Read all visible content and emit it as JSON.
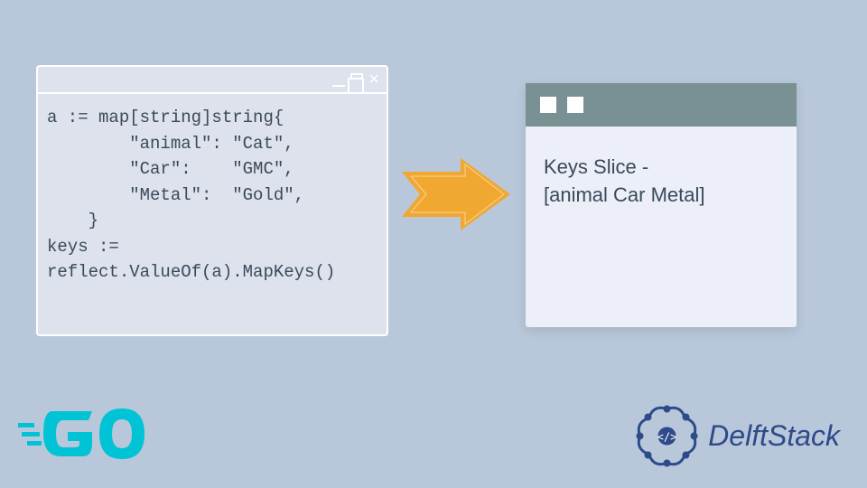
{
  "code": {
    "line1": "a := map[string]string{",
    "line2": "        \"animal\": \"Cat\",",
    "line3": "        \"Car\":    \"GMC\",",
    "line4": "        \"Metal\":  \"Gold\",",
    "line5": "    }",
    "line6": "keys :=",
    "line7": "reflect.ValueOf(a).MapKeys()"
  },
  "output": {
    "line1": "Keys Slice -",
    "line2": "[animal Car Metal]"
  },
  "logos": {
    "go": "GO",
    "delft": "DelftStack"
  },
  "colors": {
    "bg": "#b8c7d9",
    "codeWin": "#dde2ec",
    "arrow": "#f0a830",
    "outHeader": "#7a9194",
    "outBody": "#eceff7",
    "goBlue": "#00c4d6",
    "delftBlue": "#2d4a8a"
  }
}
